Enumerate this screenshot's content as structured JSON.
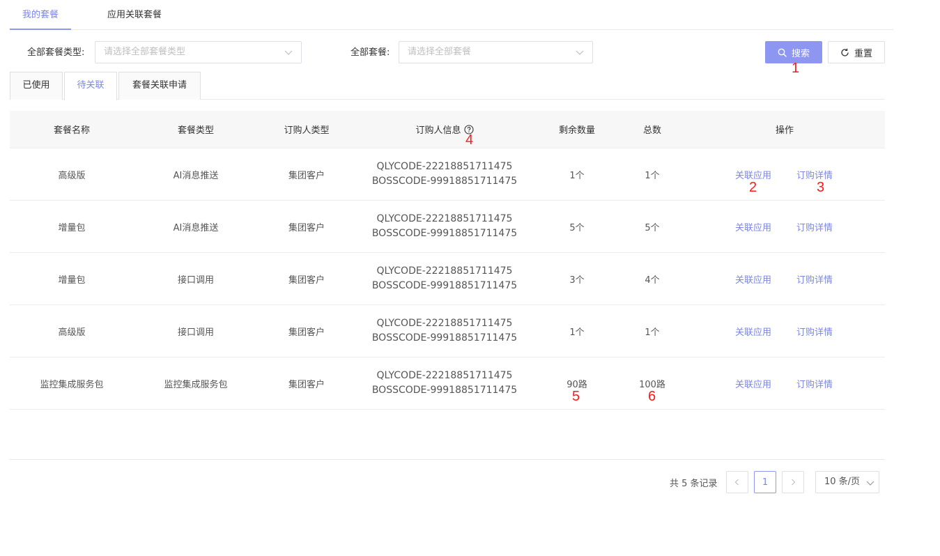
{
  "top_tabs": [
    {
      "label": "我的套餐",
      "active": true
    },
    {
      "label": "应用关联套餐",
      "active": false
    }
  ],
  "filters": {
    "type_label": "全部套餐类型:",
    "type_placeholder": "请选择全部套餐类型",
    "package_label": "全部套餐:",
    "package_placeholder": "请选择全部套餐"
  },
  "buttons": {
    "search": "搜索",
    "reset": "重置"
  },
  "sub_tabs": [
    {
      "label": "已使用",
      "active": false
    },
    {
      "label": "待关联",
      "active": true
    },
    {
      "label": "套餐关联申请",
      "active": false
    }
  ],
  "table": {
    "headers": [
      "套餐名称",
      "套餐类型",
      "订购人类型",
      "订购人信息",
      "剩余数量",
      "总数",
      "操作"
    ],
    "rows": [
      {
        "name": "高级版",
        "type": "AI消息推送",
        "buyer_type": "集团客户",
        "code1": "QLYCODE-22218851711475",
        "code2": "BOSSCODE-99918851711475",
        "remaining": "1个",
        "total": "1个",
        "action1": "关联应用",
        "action2": "订购详情"
      },
      {
        "name": "增量包",
        "type": "AI消息推送",
        "buyer_type": "集团客户",
        "code1": "QLYCODE-22218851711475",
        "code2": "BOSSCODE-99918851711475",
        "remaining": "5个",
        "total": "5个",
        "action1": "关联应用",
        "action2": "订购详情"
      },
      {
        "name": "增量包",
        "type": "接口调用",
        "buyer_type": "集团客户",
        "code1": "QLYCODE-22218851711475",
        "code2": "BOSSCODE-99918851711475",
        "remaining": "3个",
        "total": "4个",
        "action1": "关联应用",
        "action2": "订购详情"
      },
      {
        "name": "高级版",
        "type": "接口调用",
        "buyer_type": "集团客户",
        "code1": "QLYCODE-22218851711475",
        "code2": "BOSSCODE-99918851711475",
        "remaining": "1个",
        "total": "1个",
        "action1": "关联应用",
        "action2": "订购详情"
      },
      {
        "name": "监控集成服务包",
        "type": "监控集成服务包",
        "buyer_type": "集团客户",
        "code1": "QLYCODE-22218851711475",
        "code2": "BOSSCODE-99918851711475",
        "remaining": "90路",
        "total": "100路",
        "action1": "关联应用",
        "action2": "订购详情"
      }
    ]
  },
  "annotations": [
    "1",
    "2",
    "3",
    "4",
    "5",
    "6"
  ],
  "pagination": {
    "total_text": "共 5 条记录",
    "current_page": "1",
    "page_size": "10 条/页"
  },
  "colors": {
    "accent": "#8d96f0",
    "link": "#7b86e6",
    "annotation": "#ff1a1a"
  }
}
